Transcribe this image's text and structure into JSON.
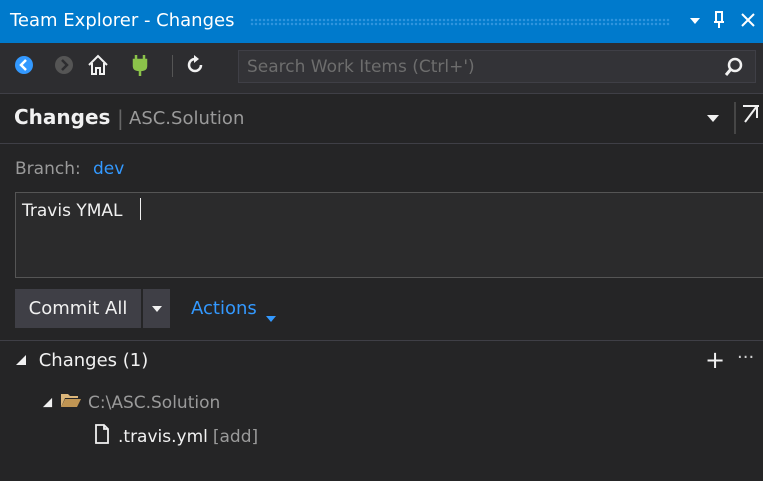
{
  "window": {
    "title": "Team Explorer - Changes",
    "title_controls": {
      "dropdown_icon": "chevron-down-icon",
      "pin_icon": "pin-icon",
      "close_icon": "close-icon"
    }
  },
  "toolbar": {
    "search_placeholder": "Search Work Items (Ctrl+')",
    "icons": [
      "back-icon",
      "forward-icon",
      "home-icon",
      "connect-icon",
      "refresh-icon",
      "search-icon"
    ]
  },
  "header": {
    "title": "Changes",
    "separator": "|",
    "subtitle": "ASC.Solution"
  },
  "branch": {
    "label": "Branch:",
    "value": "dev"
  },
  "commit": {
    "message": "Travis YMAL",
    "button_label": "Commit All",
    "actions_label": "Actions"
  },
  "changes": {
    "header": "Changes (1)",
    "folder": "C:\\ASC.Solution",
    "files": [
      {
        "name": ".travis.yml",
        "status": "[add]"
      }
    ]
  },
  "colors": {
    "accent": "#007acc",
    "link": "#3399ff",
    "background": "#252526"
  }
}
